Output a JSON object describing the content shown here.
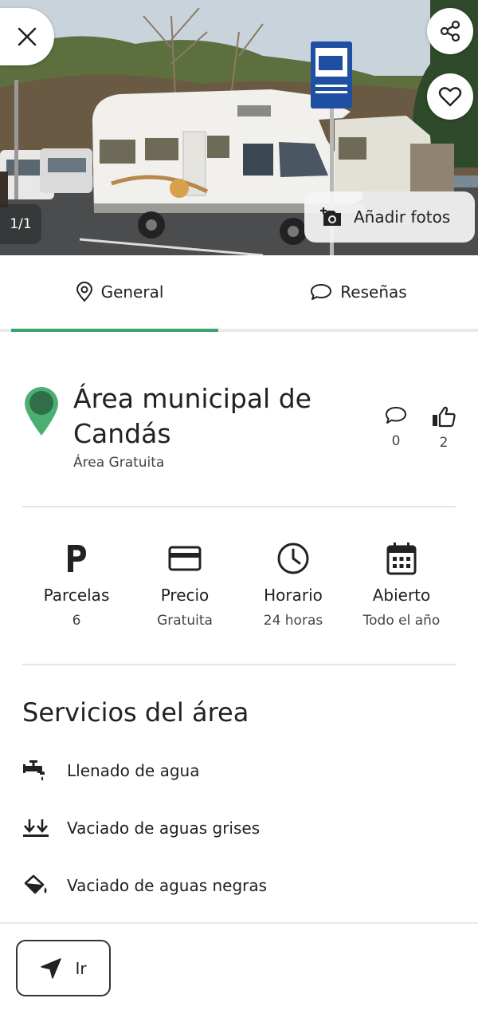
{
  "photo": {
    "counter": "1/1",
    "add_photos_label": "Añadir fotos"
  },
  "tabs": [
    {
      "label": "General",
      "icon": "location-pin-icon",
      "active": true
    },
    {
      "label": "Reseñas",
      "icon": "chat-bubble-icon",
      "active": false
    }
  ],
  "place": {
    "title": "Área municipal de Candás",
    "subtitle": "Área Gratuita",
    "comments_count": "0",
    "likes_count": "2",
    "pin_color": "#4caf72"
  },
  "info": [
    {
      "label": "Parcelas",
      "value": "6",
      "icon": "parking-icon"
    },
    {
      "label": "Precio",
      "value": "Gratuita",
      "icon": "credit-card-icon"
    },
    {
      "label": "Horario",
      "value": "24 horas",
      "icon": "clock-icon"
    },
    {
      "label": "Abierto",
      "value": "Todo el año",
      "icon": "calendar-icon"
    }
  ],
  "services": {
    "title": "Servicios del área",
    "items": [
      {
        "label": "Llenado de agua",
        "icon": "water-tap-icon"
      },
      {
        "label": "Vaciado de aguas grises",
        "icon": "grey-water-drain-icon"
      },
      {
        "label": "Vaciado de aguas negras",
        "icon": "black-water-drain-icon"
      }
    ]
  },
  "bottom": {
    "go_label": "Ir"
  },
  "colors": {
    "accent": "#3aa26c",
    "text": "#222222",
    "muted": "#444444",
    "divider": "#e4e4e4"
  }
}
